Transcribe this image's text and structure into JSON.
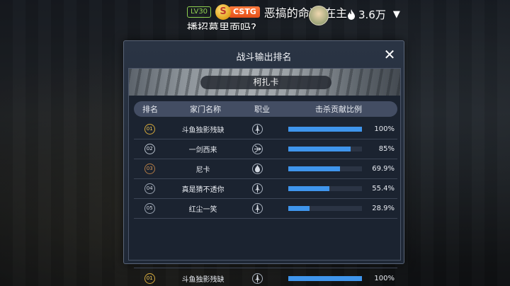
{
  "stream": {
    "level_badge": "LV30",
    "coin_letter": "S",
    "team_badge": "CSTG",
    "topic_line1": "恶搞的命运:在主",
    "topic_line2": "播招募里面吗?",
    "heat": "3.6万"
  },
  "modal": {
    "title": "战斗输出排名",
    "close_label": "✕",
    "banner_label": "柯扎卡",
    "headers": {
      "rank": "排名",
      "name": "家门名称",
      "class": "职业",
      "ratio": "击杀贡献比例"
    },
    "rows": [
      {
        "rank": "01",
        "name": "斗鱼独影残缺",
        "ratio_text": "100%",
        "ratio": 1.0,
        "tier": "gold"
      },
      {
        "rank": "02",
        "name": "一剑西来",
        "ratio_text": "85%",
        "ratio": 0.85,
        "tier": "silver"
      },
      {
        "rank": "03",
        "name": "尼卡",
        "ratio_text": "69.9%",
        "ratio": 0.699,
        "tier": "bronze"
      },
      {
        "rank": "04",
        "name": "真是猜不透你",
        "ratio_text": "55.4%",
        "ratio": 0.554,
        "tier": "plain"
      },
      {
        "rank": "05",
        "name": "红尘一笑",
        "ratio_text": "28.9%",
        "ratio": 0.289,
        "tier": "plain"
      }
    ],
    "self_row": {
      "rank": "01",
      "name": "斗鱼独影残缺",
      "ratio_text": "100%",
      "ratio": 1.0,
      "tier": "gold"
    }
  },
  "colors": {
    "bar_fill": "#3f95ec",
    "gold": "#d5a93b",
    "team_badge": "#e4501a"
  }
}
